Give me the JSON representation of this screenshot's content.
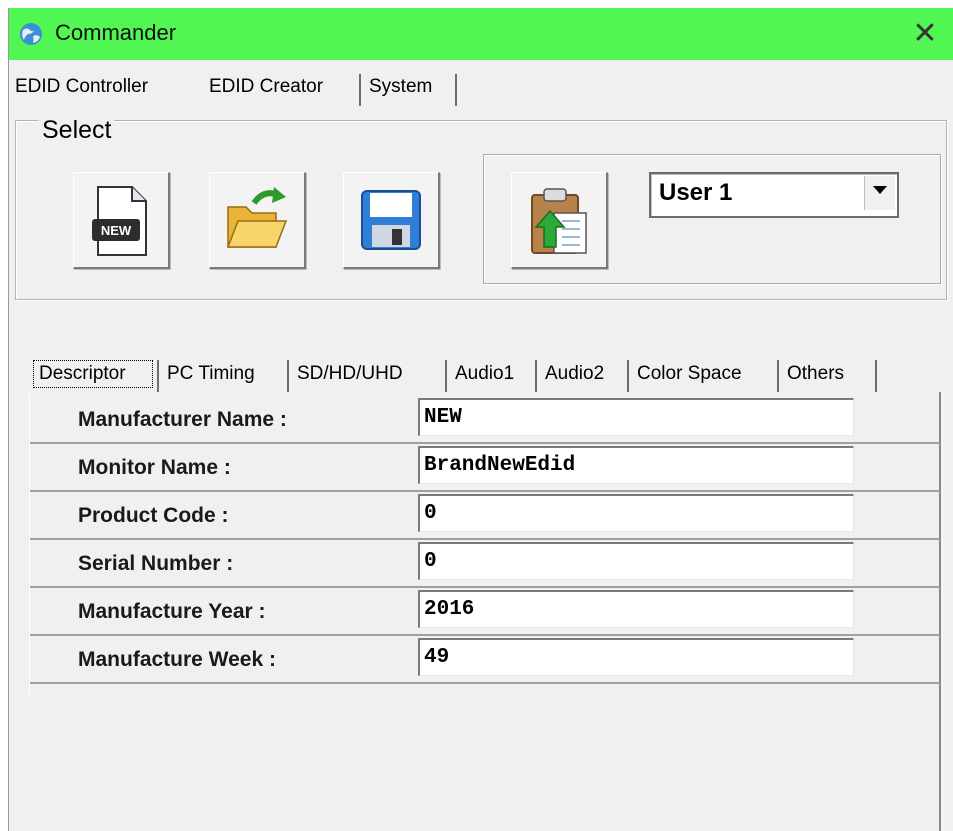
{
  "window": {
    "title": "Commander",
    "close_label": "✕"
  },
  "tabs": [
    {
      "label": "EDID Controller",
      "active": false
    },
    {
      "label": "EDID Creator",
      "active": true
    },
    {
      "label": "System",
      "active": false
    }
  ],
  "select_group": {
    "legend": "Select",
    "buttons": [
      {
        "icon": "new-file-icon",
        "badge": "NEW"
      },
      {
        "icon": "open-folder-icon"
      },
      {
        "icon": "save-disk-icon"
      },
      {
        "icon": "upload-clipboard-icon"
      }
    ],
    "dropdown": {
      "selected": "User 1"
    }
  },
  "subtabs": [
    {
      "label": "Descriptor",
      "active": true
    },
    {
      "label": "PC Timing",
      "active": false
    },
    {
      "label": "SD/HD/UHD",
      "active": false
    },
    {
      "label": "Audio1",
      "active": false
    },
    {
      "label": "Audio2",
      "active": false
    },
    {
      "label": "Color Space",
      "active": false
    },
    {
      "label": "Others",
      "active": false
    }
  ],
  "descriptor": {
    "rows": [
      {
        "label": "Manufacturer Name :",
        "value": "NEW"
      },
      {
        "label": "Monitor Name :",
        "value": "BrandNewEdid"
      },
      {
        "label": "Product Code :",
        "value": "0"
      },
      {
        "label": "Serial Number :",
        "value": "0"
      },
      {
        "label": "Manufacture Year :",
        "value": "2016"
      },
      {
        "label": "Manufacture Week :",
        "value": "49"
      }
    ]
  },
  "colors": {
    "titlebar": "#52f652",
    "background": "#f0f0f0"
  }
}
